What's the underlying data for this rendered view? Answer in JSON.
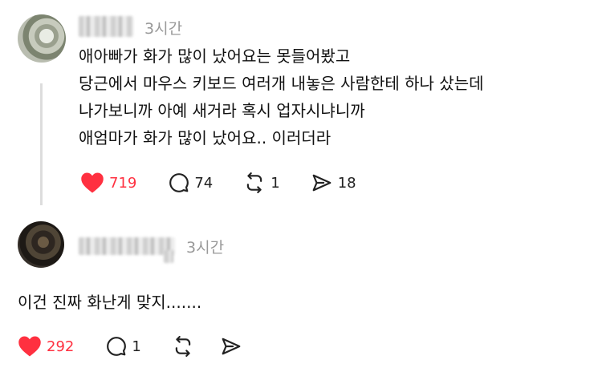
{
  "comments": [
    {
      "time": "3시간",
      "lines": [
        "애아빠가 화가 많이 났어요는 못들어봤고",
        "당근에서 마우스 키보드 여러개 내놓은 사람한테 하나 샀는데",
        "나가보니까 아예 새거라 혹시 업자시냐니까",
        "애엄마가 화가 많이 났어요.. 이러더라"
      ],
      "likes": "719",
      "replies": "74",
      "reposts": "1",
      "shares": "18"
    },
    {
      "time": "3시간",
      "lines": [
        "이건 진짜 화난게 맞지......."
      ],
      "likes": "292",
      "replies": "1"
    }
  ],
  "colors": {
    "like": "#ff3040",
    "muted": "#999999",
    "icon": "#222222"
  },
  "icons": [
    "heart-icon",
    "comment-icon",
    "repost-icon",
    "share-icon"
  ]
}
